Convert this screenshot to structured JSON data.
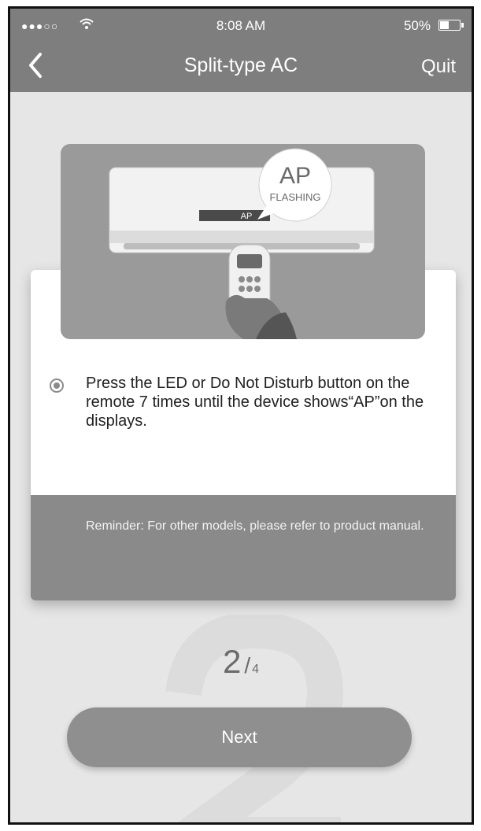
{
  "status_bar": {
    "time": "8:08 AM",
    "battery": "50%",
    "battery_level": 0.5
  },
  "nav": {
    "title": "Split-type AC",
    "quit_label": "Quit"
  },
  "illustration": {
    "bubble_main": "AP",
    "bubble_sub": "FLASHING",
    "display_text": "AP"
  },
  "instruction": {
    "text": "Press the LED or Do Not Disturb button on the remote 7 times until the device shows“AP”on the displays."
  },
  "reminder": {
    "text": "Reminder: For other models, please refer to product manual."
  },
  "step": {
    "current": "2",
    "separator": "/",
    "total": "4"
  },
  "next_button": {
    "label": "Next"
  },
  "colors": {
    "header": "#7e7e7e",
    "background": "#e6e6e6",
    "button": "#8f8f8f",
    "reminder": "#8a8a8a"
  }
}
